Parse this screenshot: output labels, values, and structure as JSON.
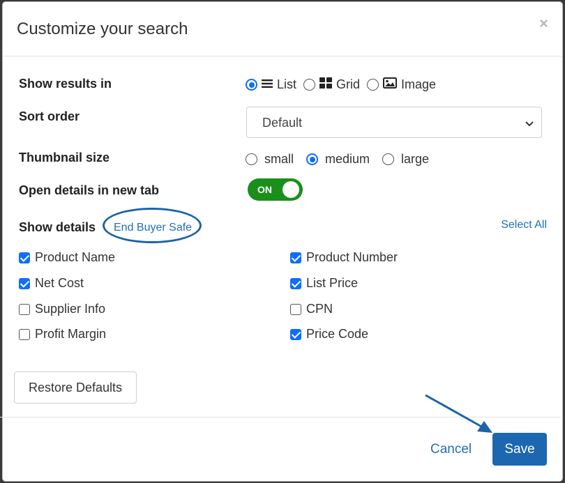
{
  "modal": {
    "title": "Customize your search",
    "close_glyph": "×"
  },
  "show_results": {
    "label": "Show results in",
    "options": [
      "List",
      "Grid",
      "Image"
    ],
    "selected": "List"
  },
  "sort_order": {
    "label": "Sort order",
    "value": "Default"
  },
  "thumbnail": {
    "label": "Thumbnail size",
    "options": [
      "small",
      "medium",
      "large"
    ],
    "selected": "medium"
  },
  "open_details": {
    "label": "Open details in new tab",
    "toggle_text": "ON",
    "on": true
  },
  "show_details": {
    "label": "Show details",
    "end_buyer_safe": "End Buyer Safe",
    "select_all": "Select All",
    "items": [
      {
        "label": "Product Name",
        "checked": true
      },
      {
        "label": "Product Number",
        "checked": true
      },
      {
        "label": "Net Cost",
        "checked": true
      },
      {
        "label": "List Price",
        "checked": true
      },
      {
        "label": "Supplier Info",
        "checked": false
      },
      {
        "label": "CPN",
        "checked": false
      },
      {
        "label": "Profit Margin",
        "checked": false
      },
      {
        "label": "Price Code",
        "checked": true
      }
    ]
  },
  "buttons": {
    "restore": "Restore Defaults",
    "cancel": "Cancel",
    "save": "Save"
  },
  "colors": {
    "accent": "#0d6efd",
    "save_bg": "#1c67b0",
    "toggle_on": "#1a8f1a",
    "annotation": "#1d63a8"
  },
  "icons": {
    "list": "list-icon",
    "grid": "grid-icon",
    "image": "image-icon",
    "chevron": "chevron-down-icon"
  }
}
